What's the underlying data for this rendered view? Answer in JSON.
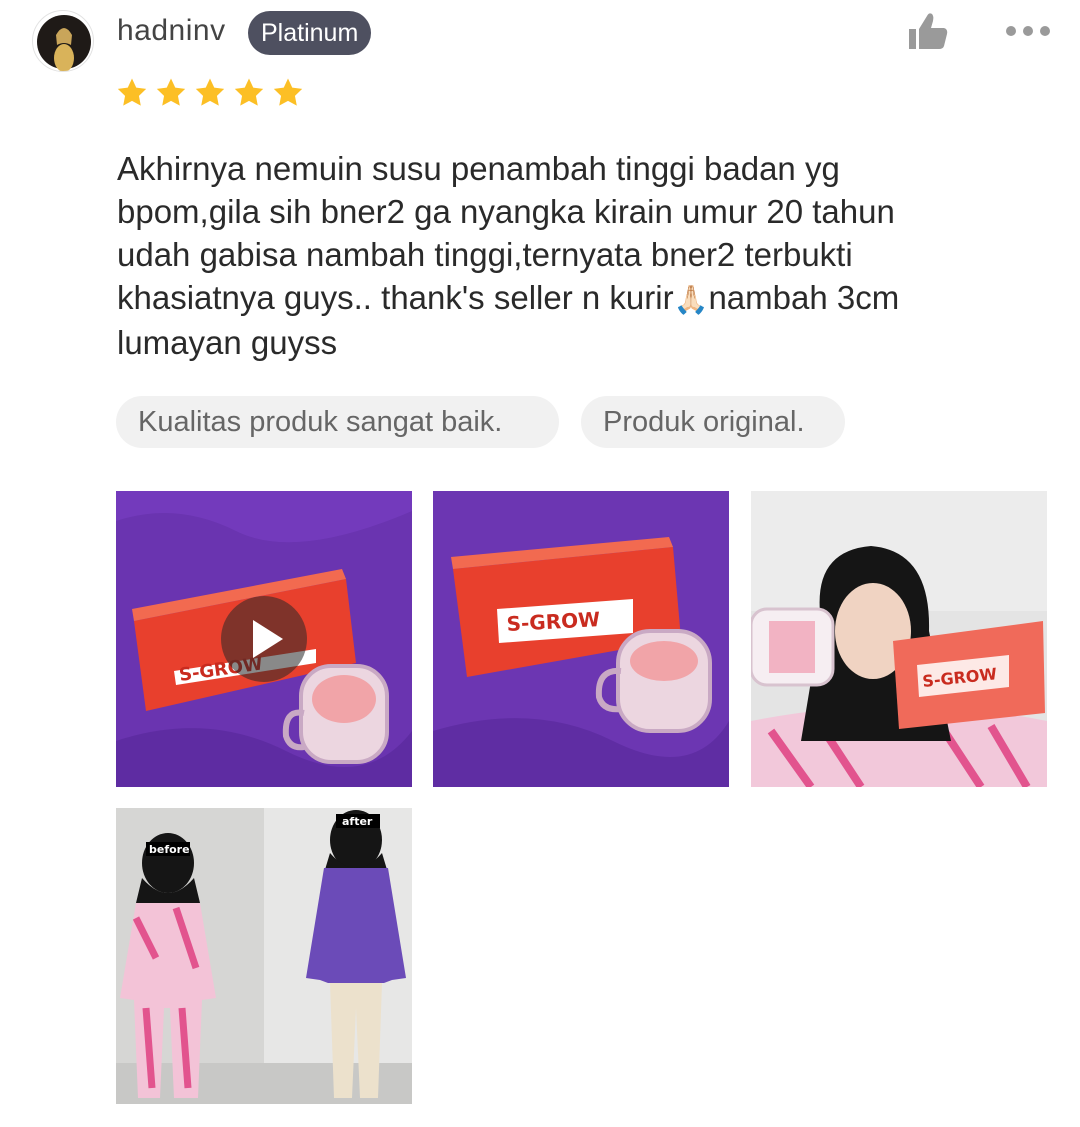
{
  "review": {
    "username": "hadninv",
    "badge": "Platinum",
    "rating": 5,
    "text_main": "Akhirnya nemuin susu penambah tinggi badan yg\nbpom,gila sih bner2 ga nyangka kirain umur 20 tahun\nudah gabisa nambah tinggi,ternyata bner2 terbukti\nkhasiatnya guys.. thank's seller n kurir",
    "text_emoji": "🙏🏻",
    "text_tail": "nambah 3cm\nlumayan guyss",
    "tags": [
      "Kualitas produk sangat baik.",
      "Produk original."
    ]
  },
  "media": {
    "product_brand": "S-GROW",
    "before_label": "before",
    "after_label": "after"
  },
  "icons": {
    "like": "thumbs-up-icon",
    "more": "more-horizontal-icon",
    "star": "star-icon",
    "play": "play-icon"
  },
  "colors": {
    "badge_bg": "#4e5060",
    "star": "#fcbf25",
    "icon_gray": "#9a9a9a",
    "tag_bg": "#f1f1f1"
  }
}
